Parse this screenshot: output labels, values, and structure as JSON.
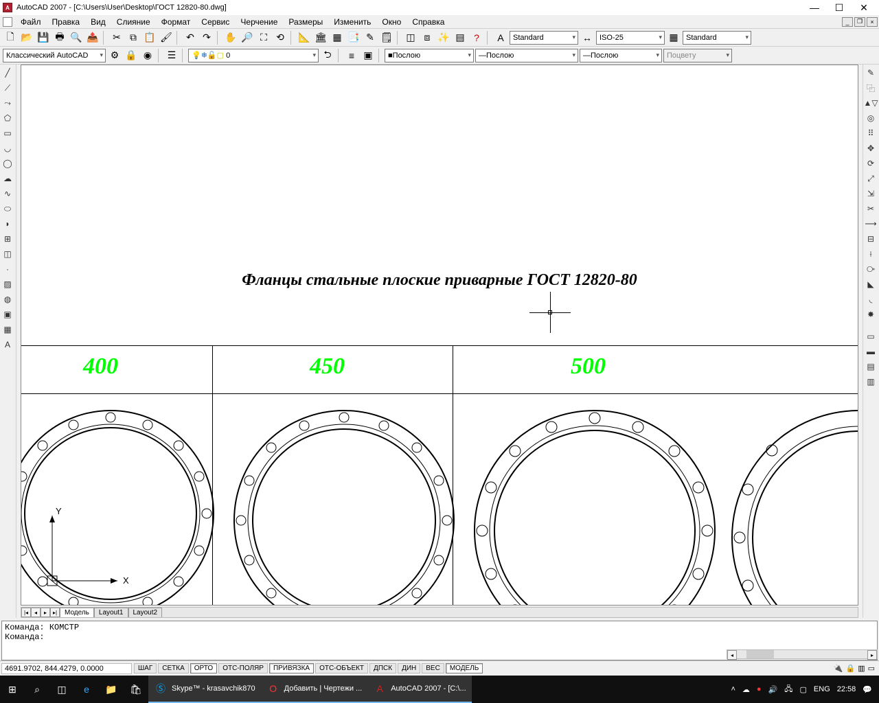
{
  "title": "AutoCAD 2007 - [C:\\Users\\User\\Desktop\\ГОСТ 12820-80.dwg]",
  "menus": [
    "Файл",
    "Правка",
    "Вид",
    "Слияние",
    "Формат",
    "Сервис",
    "Черчение",
    "Размеры",
    "Изменить",
    "Окно",
    "Справка"
  ],
  "workspace": "Классический AutoCAD",
  "layer": "0",
  "textStyle": "Standard",
  "dimStyle": "ISO-25",
  "tableStyle": "Standard",
  "lineColor": "Послою",
  "lineType": "Послою",
  "lineWeight": "Послою",
  "plotStyle": "Поцвету",
  "drawing": {
    "title": "Фланцы стальные плоские приварные ГОСТ 12820-80",
    "sizes": [
      "400",
      "450",
      "500"
    ]
  },
  "tabs": {
    "model": "Модель",
    "l1": "Layout1",
    "l2": "Layout2"
  },
  "command": {
    "label": "Команда:",
    "last": "КОМСТР"
  },
  "status": {
    "coords": "4691.9702, 844.4279, 0.0000",
    "buttons": [
      "ШАГ",
      "СЕТКА",
      "ОРТО",
      "ОТС-ПОЛЯР",
      "ПРИВЯЗКА",
      "ОТС-ОБЪЕКТ",
      "ДПСК",
      "ДИН",
      "ВЕС",
      "МОДЕЛЬ"
    ]
  },
  "taskbar": {
    "skype": "Skype™ - krasavchik870",
    "opera": "Добавить | Чертежи ...",
    "acad": "AutoCAD 2007 - [C:\\...",
    "lang": "ENG",
    "time": "22:58"
  },
  "ucs": {
    "x": "X",
    "y": "Y"
  }
}
